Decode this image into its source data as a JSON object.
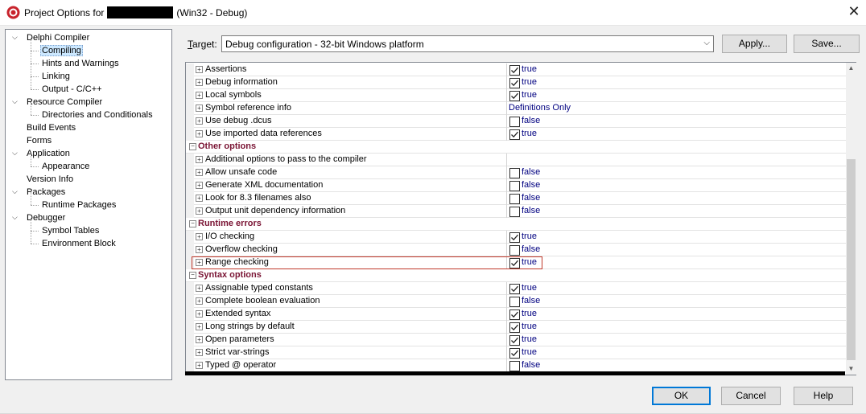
{
  "window": {
    "title_prefix": "Project Options for",
    "title_suffix": "(Win32 - Debug)"
  },
  "icons": {
    "app": "delphi-app-icon",
    "close": "close-icon",
    "expand": "expand-icon",
    "collapse": "collapse-icon",
    "check": "check-icon"
  },
  "colors": {
    "accent": "#0078d7",
    "category": "#7a1434",
    "value": "#000080",
    "highlight": "#c0392b",
    "selected_bg": "#cce8ff"
  },
  "tree": [
    {
      "label": "Delphi Compiler",
      "level": 0,
      "expanded": true
    },
    {
      "label": "Compiling",
      "level": 1,
      "selected": true
    },
    {
      "label": "Hints and Warnings",
      "level": 1
    },
    {
      "label": "Linking",
      "level": 1
    },
    {
      "label": "Output - C/C++",
      "level": 1
    },
    {
      "label": "Resource Compiler",
      "level": 0,
      "expanded": true
    },
    {
      "label": "Directories and Conditionals",
      "level": 1
    },
    {
      "label": "Build Events",
      "level": 0
    },
    {
      "label": "Forms",
      "level": 0
    },
    {
      "label": "Application",
      "level": 0,
      "expanded": true
    },
    {
      "label": "Appearance",
      "level": 1
    },
    {
      "label": "Version Info",
      "level": 0
    },
    {
      "label": "Packages",
      "level": 0,
      "expanded": true
    },
    {
      "label": "Runtime Packages",
      "level": 1
    },
    {
      "label": "Debugger",
      "level": 0,
      "expanded": true
    },
    {
      "label": "Symbol Tables",
      "level": 1
    },
    {
      "label": "Environment Block",
      "level": 1
    }
  ],
  "target": {
    "label_underlined": "T",
    "label_rest": "arget:",
    "value": "Debug configuration - 32-bit Windows platform"
  },
  "buttons": {
    "apply": "Apply...",
    "save": "Save...",
    "ok": "OK",
    "cancel": "Cancel",
    "help": "Help"
  },
  "rows": [
    {
      "type": "option",
      "name": "Assertions",
      "kind": "bool",
      "checked": true,
      "value": "true"
    },
    {
      "type": "option",
      "name": "Debug information",
      "kind": "bool",
      "checked": true,
      "value": "true"
    },
    {
      "type": "option",
      "name": "Local symbols",
      "kind": "bool",
      "checked": true,
      "value": "true"
    },
    {
      "type": "option",
      "name": "Symbol reference info",
      "kind": "text",
      "value": "Definitions Only"
    },
    {
      "type": "option",
      "name": "Use debug .dcus",
      "kind": "bool",
      "checked": false,
      "value": "false"
    },
    {
      "type": "option",
      "name": "Use imported data references",
      "kind": "bool",
      "checked": true,
      "value": "true"
    },
    {
      "type": "category",
      "name": "Other options"
    },
    {
      "type": "option",
      "name": "Additional options to pass to the compiler",
      "kind": "text",
      "value": ""
    },
    {
      "type": "option",
      "name": "Allow unsafe code",
      "kind": "bool",
      "checked": false,
      "value": "false"
    },
    {
      "type": "option",
      "name": "Generate XML documentation",
      "kind": "bool",
      "checked": false,
      "value": "false"
    },
    {
      "type": "option",
      "name": "Look for 8.3 filenames also",
      "kind": "bool",
      "checked": false,
      "value": "false"
    },
    {
      "type": "option",
      "name": "Output unit dependency information",
      "kind": "bool",
      "checked": false,
      "value": "false"
    },
    {
      "type": "category",
      "name": "Runtime errors"
    },
    {
      "type": "option",
      "name": "I/O checking",
      "kind": "bool",
      "checked": true,
      "value": "true"
    },
    {
      "type": "option",
      "name": "Overflow checking",
      "kind": "bool",
      "checked": false,
      "value": "false"
    },
    {
      "type": "option",
      "name": "Range checking",
      "kind": "bool",
      "checked": true,
      "value": "true",
      "highlighted": true
    },
    {
      "type": "category",
      "name": "Syntax options"
    },
    {
      "type": "option",
      "name": "Assignable typed constants",
      "kind": "bool",
      "checked": true,
      "value": "true"
    },
    {
      "type": "option",
      "name": "Complete boolean evaluation",
      "kind": "bool",
      "checked": false,
      "value": "false"
    },
    {
      "type": "option",
      "name": "Extended syntax",
      "kind": "bool",
      "checked": true,
      "value": "true"
    },
    {
      "type": "option",
      "name": "Long strings by default",
      "kind": "bool",
      "checked": true,
      "value": "true"
    },
    {
      "type": "option",
      "name": "Open parameters",
      "kind": "bool",
      "checked": true,
      "value": "true"
    },
    {
      "type": "option",
      "name": "Strict var-strings",
      "kind": "bool",
      "checked": true,
      "value": "true"
    },
    {
      "type": "option",
      "name": "Typed @ operator",
      "kind": "bool",
      "checked": false,
      "value": "false"
    }
  ]
}
